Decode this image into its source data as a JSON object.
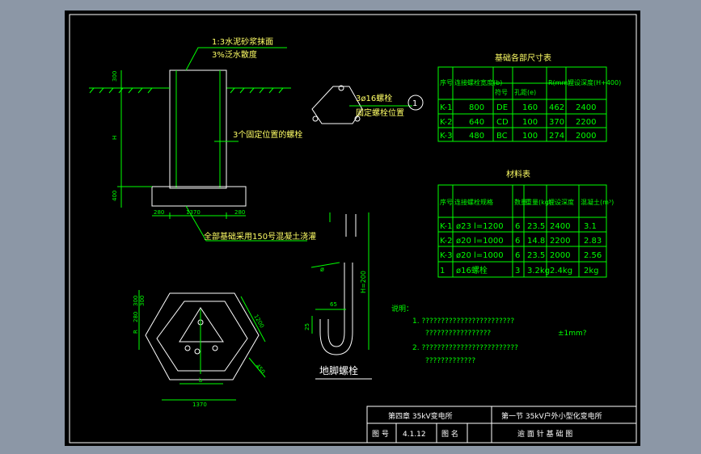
{
  "title_block": {
    "chapter": "第四章 35kV变电所",
    "section": "第一节 35kV户外小型化变电所",
    "drawing_no_label": "图 号",
    "drawing_no": "4.1.12",
    "drawing_name_label": "图 名",
    "drawing_name": "逾 面 针 基 础 图"
  },
  "elevation": {
    "note_mortar": "1:3水泥砂浆抹面",
    "note_slope": "3%泛水散度",
    "note_bolts": "3个固定位置的螺栓",
    "note_concrete": "全部基础采用150号混凝土浇灌",
    "dim_300": "300",
    "dim_H": "H",
    "dim_400": "400",
    "dim_280a": "280",
    "dim_1370": "1370",
    "dim_280b": "280"
  },
  "bolt_detail": {
    "label": "3ø16螺栓",
    "label2": "固定螺栓位置",
    "callout": "1"
  },
  "table1": {
    "title": "基础各部尺寸表",
    "headers": [
      "序号",
      "连接螺栓宽度(b)",
      "符号",
      "孔距(e)",
      "R(mm)",
      "埋设深度(H+400)"
    ],
    "rows": [
      [
        "K-1",
        "800",
        "DE",
        "160",
        "462",
        "2400"
      ],
      [
        "K-2",
        "640",
        "CD",
        "100",
        "370",
        "2200"
      ],
      [
        "K-3",
        "480",
        "BC",
        "100",
        "274",
        "2000"
      ]
    ]
  },
  "table2": {
    "title": "材料表",
    "headers": [
      "序号",
      "连接螺栓规格",
      "数量",
      "重量(kg)",
      "埋设深度",
      "混凝土(m³)"
    ],
    "rows": [
      [
        "K-1",
        "ø23 l=1200",
        "6",
        "23.5",
        "2400",
        "3.1"
      ],
      [
        "K-2",
        "ø20 l=1000",
        "6",
        "14.8",
        "2200",
        "2.83"
      ],
      [
        "K-3",
        "ø20 l=1000",
        "6",
        "23.5",
        "2000",
        "2.56"
      ],
      [
        "1",
        "ø16螺栓",
        "3",
        "3.2kg",
        "2.4kg",
        "2kg"
      ]
    ]
  },
  "anchor": {
    "title": "地脚螺栓",
    "dim_phi": "ø",
    "dim_H": "H=200",
    "dim_65": "65",
    "dim_25": "25"
  },
  "plan": {
    "dim_1370": "1370",
    "dim_b": "b",
    "dim_300a": "300",
    "dim_300b": "300",
    "dim_280": "280",
    "dim_R": "R",
    "dim_1200": "1200",
    "dim_450": "450"
  },
  "notes": {
    "heading": "说明：",
    "line1": "1. ????????????????????????",
    "line1b": "?????????????????",
    "tolerance": "±1mm?",
    "line2": "2. ?????????????????????????",
    "line2b": "?????????????"
  }
}
